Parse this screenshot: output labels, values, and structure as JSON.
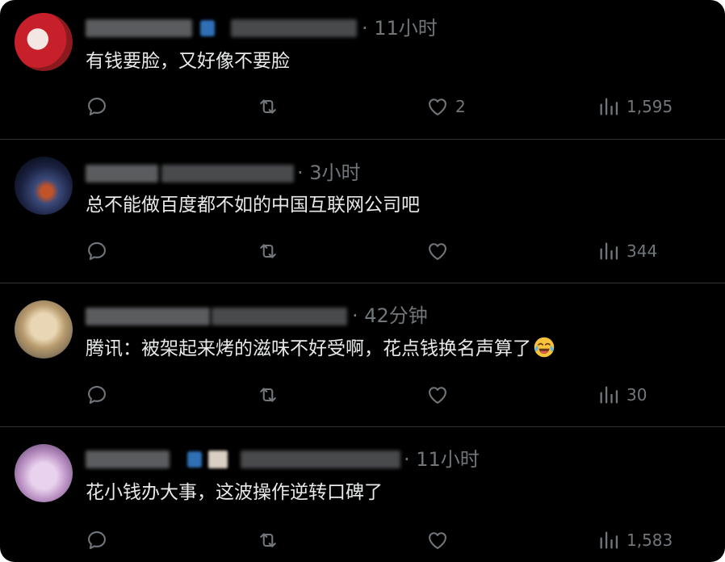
{
  "tweets": [
    {
      "time": "· 11小时",
      "text": "有钱要脸，又好像不要脸",
      "likes": "2",
      "views": "1,595"
    },
    {
      "time": "· 3小时",
      "text": "总不能做百度都不如的中国互联网公司吧",
      "likes": "",
      "views": "344"
    },
    {
      "time": "· 42分钟",
      "text": "腾讯：被架起来烤的滋味不好受啊，花点钱换名声算了",
      "emoji": "face-with-tears-of-joy",
      "likes": "",
      "views": "30"
    },
    {
      "time": "· 11小时",
      "text": "花小钱办大事，这波操作逆转口碑了",
      "likes": "",
      "views": "1,583"
    }
  ],
  "colors": {
    "background": "#000000",
    "text": "#e7e9ea",
    "muted": "#71767b",
    "divider": "#2f3336"
  },
  "icons": [
    "reply-icon",
    "retweet-icon",
    "like-icon",
    "views-icon"
  ]
}
